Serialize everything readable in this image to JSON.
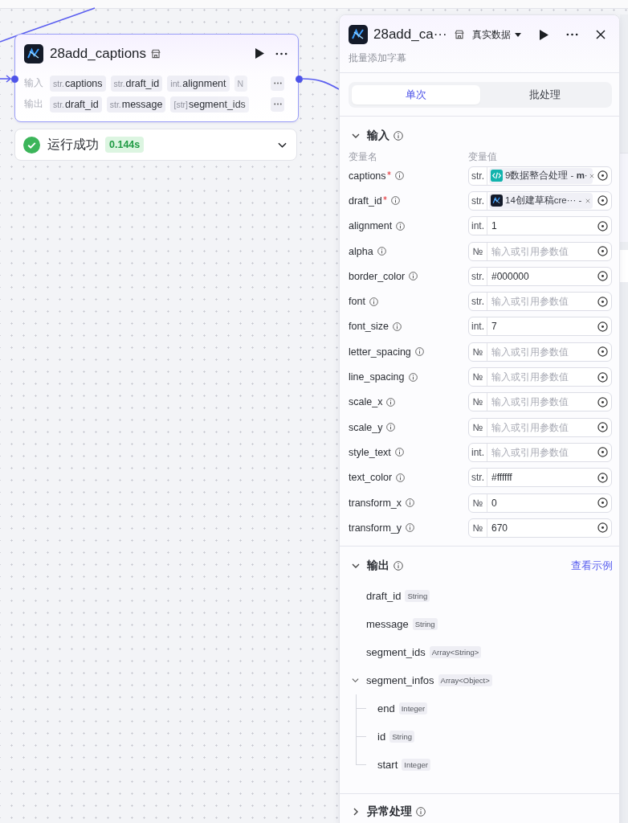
{
  "canvas_node": {
    "title": "28add_captions",
    "rows": [
      {
        "label": "输入",
        "chips": [
          {
            "type": "str.",
            "name": "captions"
          },
          {
            "type": "str.",
            "name": "draft_id"
          },
          {
            "type": "int.",
            "name": "alignment"
          },
          {
            "type": "N"
          }
        ]
      },
      {
        "label": "输出",
        "chips": [
          {
            "type": "str.",
            "name": "draft_id"
          },
          {
            "type": "str.",
            "name": "message"
          },
          {
            "type": "[str]",
            "name": "segment_ids"
          }
        ]
      }
    ]
  },
  "run_status": {
    "success": true,
    "text": "运行成功",
    "duration": "0.144s",
    "expanded": false
  },
  "panel": {
    "title": "28add_ca···",
    "data_source": "真实数据",
    "subtitle": "批量添加字幕",
    "tabs": [
      {
        "label": "单次",
        "selected": true
      },
      {
        "label": "批处理",
        "selected": false
      }
    ],
    "input_section": {
      "title": "输入",
      "expanded": true,
      "columns": [
        "变量名",
        "变量值"
      ],
      "params": [
        {
          "name": "captions",
          "required": true,
          "type": "str.",
          "kind": "reference",
          "ref": {
            "kind": "code",
            "label": "9数据整合处理 - **m**·"
          }
        },
        {
          "name": "draft_id",
          "required": true,
          "type": "str.",
          "kind": "reference",
          "ref": {
            "kind": "node",
            "label": "14创建草稿cre··· -"
          }
        },
        {
          "name": "alignment",
          "required": false,
          "type": "int.",
          "kind": "value",
          "value": "1"
        },
        {
          "name": "alpha",
          "required": false,
          "type": "№",
          "kind": "empty",
          "placeholder": "输入或引用参数值"
        },
        {
          "name": "border_color",
          "required": false,
          "type": "str.",
          "kind": "value",
          "value": "#000000"
        },
        {
          "name": "font",
          "required": false,
          "type": "str.",
          "kind": "empty",
          "placeholder": "输入或引用参数值"
        },
        {
          "name": "font_size",
          "required": false,
          "type": "int.",
          "kind": "value",
          "value": "7"
        },
        {
          "name": "letter_spacing",
          "required": false,
          "type": "№",
          "kind": "empty",
          "placeholder": "输入或引用参数值"
        },
        {
          "name": "line_spacing",
          "required": false,
          "type": "№",
          "kind": "empty",
          "placeholder": "输入或引用参数值"
        },
        {
          "name": "scale_x",
          "required": false,
          "type": "№",
          "kind": "empty",
          "placeholder": "输入或引用参数值"
        },
        {
          "name": "scale_y",
          "required": false,
          "type": "№",
          "kind": "empty",
          "placeholder": "输入或引用参数值"
        },
        {
          "name": "style_text",
          "required": false,
          "type": "int.",
          "kind": "empty",
          "placeholder": "输入或引用参数值"
        },
        {
          "name": "text_color",
          "required": false,
          "type": "str.",
          "kind": "value",
          "value": "#ffffff"
        },
        {
          "name": "transform_x",
          "required": false,
          "type": "№",
          "kind": "value",
          "value": "0"
        },
        {
          "name": "transform_y",
          "required": false,
          "type": "№",
          "kind": "value",
          "value": "670"
        }
      ]
    },
    "output_section": {
      "title": "输出",
      "expanded": true,
      "link": "查看示例",
      "fields": [
        {
          "name": "draft_id",
          "type": "String"
        },
        {
          "name": "message",
          "type": "String"
        },
        {
          "name": "segment_ids",
          "type": "Array<String>"
        },
        {
          "name": "segment_infos",
          "type": "Array<Object>",
          "expanded": true,
          "children": [
            {
              "name": "end",
              "type": "Integer"
            },
            {
              "name": "id",
              "type": "String"
            },
            {
              "name": "start",
              "type": "Integer"
            }
          ]
        }
      ]
    },
    "error_section": {
      "title": "异常处理",
      "expanded": false
    }
  }
}
